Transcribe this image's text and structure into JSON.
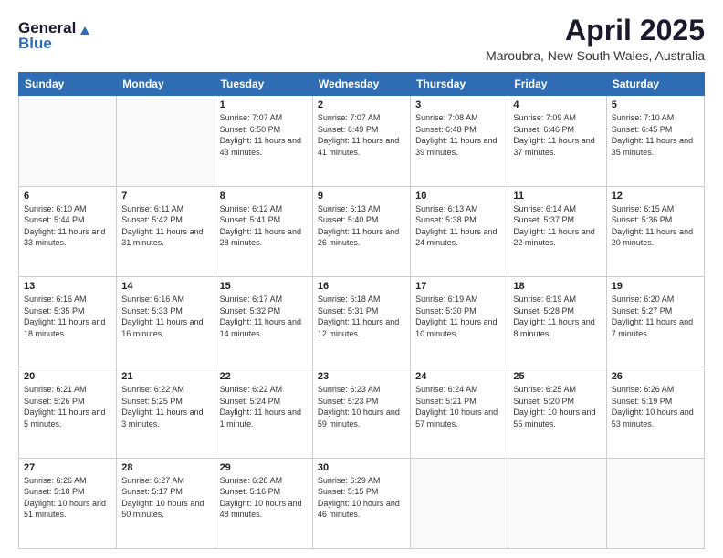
{
  "header": {
    "logo_general": "General",
    "logo_blue": "Blue",
    "month": "April 2025",
    "location": "Maroubra, New South Wales, Australia"
  },
  "weekdays": [
    "Sunday",
    "Monday",
    "Tuesday",
    "Wednesday",
    "Thursday",
    "Friday",
    "Saturday"
  ],
  "weeks": [
    [
      {
        "day": "",
        "info": ""
      },
      {
        "day": "",
        "info": ""
      },
      {
        "day": "1",
        "info": "Sunrise: 7:07 AM\nSunset: 6:50 PM\nDaylight: 11 hours and 43 minutes."
      },
      {
        "day": "2",
        "info": "Sunrise: 7:07 AM\nSunset: 6:49 PM\nDaylight: 11 hours and 41 minutes."
      },
      {
        "day": "3",
        "info": "Sunrise: 7:08 AM\nSunset: 6:48 PM\nDaylight: 11 hours and 39 minutes."
      },
      {
        "day": "4",
        "info": "Sunrise: 7:09 AM\nSunset: 6:46 PM\nDaylight: 11 hours and 37 minutes."
      },
      {
        "day": "5",
        "info": "Sunrise: 7:10 AM\nSunset: 6:45 PM\nDaylight: 11 hours and 35 minutes."
      }
    ],
    [
      {
        "day": "6",
        "info": "Sunrise: 6:10 AM\nSunset: 5:44 PM\nDaylight: 11 hours and 33 minutes."
      },
      {
        "day": "7",
        "info": "Sunrise: 6:11 AM\nSunset: 5:42 PM\nDaylight: 11 hours and 31 minutes."
      },
      {
        "day": "8",
        "info": "Sunrise: 6:12 AM\nSunset: 5:41 PM\nDaylight: 11 hours and 28 minutes."
      },
      {
        "day": "9",
        "info": "Sunrise: 6:13 AM\nSunset: 5:40 PM\nDaylight: 11 hours and 26 minutes."
      },
      {
        "day": "10",
        "info": "Sunrise: 6:13 AM\nSunset: 5:38 PM\nDaylight: 11 hours and 24 minutes."
      },
      {
        "day": "11",
        "info": "Sunrise: 6:14 AM\nSunset: 5:37 PM\nDaylight: 11 hours and 22 minutes."
      },
      {
        "day": "12",
        "info": "Sunrise: 6:15 AM\nSunset: 5:36 PM\nDaylight: 11 hours and 20 minutes."
      }
    ],
    [
      {
        "day": "13",
        "info": "Sunrise: 6:16 AM\nSunset: 5:35 PM\nDaylight: 11 hours and 18 minutes."
      },
      {
        "day": "14",
        "info": "Sunrise: 6:16 AM\nSunset: 5:33 PM\nDaylight: 11 hours and 16 minutes."
      },
      {
        "day": "15",
        "info": "Sunrise: 6:17 AM\nSunset: 5:32 PM\nDaylight: 11 hours and 14 minutes."
      },
      {
        "day": "16",
        "info": "Sunrise: 6:18 AM\nSunset: 5:31 PM\nDaylight: 11 hours and 12 minutes."
      },
      {
        "day": "17",
        "info": "Sunrise: 6:19 AM\nSunset: 5:30 PM\nDaylight: 11 hours and 10 minutes."
      },
      {
        "day": "18",
        "info": "Sunrise: 6:19 AM\nSunset: 5:28 PM\nDaylight: 11 hours and 8 minutes."
      },
      {
        "day": "19",
        "info": "Sunrise: 6:20 AM\nSunset: 5:27 PM\nDaylight: 11 hours and 7 minutes."
      }
    ],
    [
      {
        "day": "20",
        "info": "Sunrise: 6:21 AM\nSunset: 5:26 PM\nDaylight: 11 hours and 5 minutes."
      },
      {
        "day": "21",
        "info": "Sunrise: 6:22 AM\nSunset: 5:25 PM\nDaylight: 11 hours and 3 minutes."
      },
      {
        "day": "22",
        "info": "Sunrise: 6:22 AM\nSunset: 5:24 PM\nDaylight: 11 hours and 1 minute."
      },
      {
        "day": "23",
        "info": "Sunrise: 6:23 AM\nSunset: 5:23 PM\nDaylight: 10 hours and 59 minutes."
      },
      {
        "day": "24",
        "info": "Sunrise: 6:24 AM\nSunset: 5:21 PM\nDaylight: 10 hours and 57 minutes."
      },
      {
        "day": "25",
        "info": "Sunrise: 6:25 AM\nSunset: 5:20 PM\nDaylight: 10 hours and 55 minutes."
      },
      {
        "day": "26",
        "info": "Sunrise: 6:26 AM\nSunset: 5:19 PM\nDaylight: 10 hours and 53 minutes."
      }
    ],
    [
      {
        "day": "27",
        "info": "Sunrise: 6:26 AM\nSunset: 5:18 PM\nDaylight: 10 hours and 51 minutes."
      },
      {
        "day": "28",
        "info": "Sunrise: 6:27 AM\nSunset: 5:17 PM\nDaylight: 10 hours and 50 minutes."
      },
      {
        "day": "29",
        "info": "Sunrise: 6:28 AM\nSunset: 5:16 PM\nDaylight: 10 hours and 48 minutes."
      },
      {
        "day": "30",
        "info": "Sunrise: 6:29 AM\nSunset: 5:15 PM\nDaylight: 10 hours and 46 minutes."
      },
      {
        "day": "",
        "info": ""
      },
      {
        "day": "",
        "info": ""
      },
      {
        "day": "",
        "info": ""
      }
    ]
  ]
}
